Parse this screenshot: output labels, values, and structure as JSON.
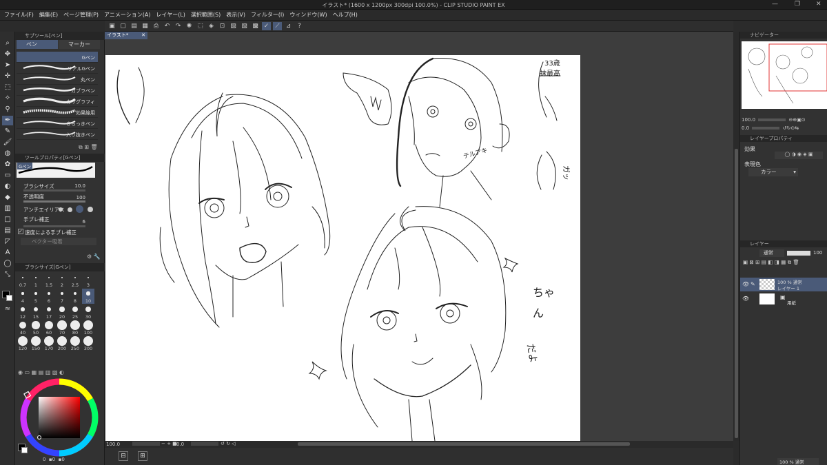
{
  "title": "イラスト* (1600 x 1200px 300dpi 100.0%) - CLIP STUDIO PAINT EX",
  "menu": [
    "ファイル(F)",
    "編集(E)",
    "ページ管理(P)",
    "アニメーション(A)",
    "レイヤー(L)",
    "選択範囲(S)",
    "表示(V)",
    "フィルター(I)",
    "ウィンドウ(W)",
    "ヘルプ(H)"
  ],
  "subtool": {
    "header": "サブツール[ペン]",
    "tab_pen": "ペン",
    "tab_marker": "マーカー",
    "brushes": [
      "Gペン",
      "リアルGペン",
      "丸ペン",
      "カブラペン",
      "カリグラフィ",
      "効果線用",
      "さらっきペン",
      "入り抜きペン"
    ]
  },
  "toolprop": {
    "header": "ツールプロパティ[Gペン]",
    "brush_name": "Gペン",
    "brush_size_label": "ブラシサイズ",
    "brush_size_value": "10.0",
    "opacity_label": "不透明度",
    "opacity_value": "100",
    "antialias_label": "アンチエイリアス",
    "stabilization_label": "手ブレ補正",
    "stabilization_value": "6",
    "speed_stab_label": "速度による手ブレ補正",
    "vector_label": "ベクター吸着"
  },
  "brushsize": {
    "header": "ブラシサイズ[Gペン]",
    "sizes": [
      "0.7",
      "1",
      "1.5",
      "2",
      "2.5",
      "3",
      "4",
      "5",
      "6",
      "7",
      "8",
      "10",
      "12",
      "15",
      "17",
      "20",
      "25",
      "30",
      "40",
      "50",
      "60",
      "70",
      "80",
      "100",
      "120",
      "150",
      "170",
      "200",
      "250",
      "300"
    ]
  },
  "colors": {
    "main": "#000000",
    "sub": "#ffffff",
    "accent": "#4a5a78",
    "picker_hue": "#ff0000"
  },
  "color_values": {
    "a": "0",
    "b": "0",
    "c": "0"
  },
  "document": {
    "tab": "イラスト*",
    "status_zoom": "100.0",
    "status_angle": "0.0"
  },
  "annotations": {
    "top_right_1": "33歳",
    "top_right_2": "抹最高",
    "side_name": "テルアキ",
    "side_text": "ガッ",
    "right_text_1": "ちゃ",
    "right_text_2": "ん",
    "right_text_3": "だよ"
  },
  "navigator": {
    "header": "ナビゲーター",
    "zoom": "100.0",
    "angle": "0.0"
  },
  "layerprop": {
    "header": "レイヤープロパティ",
    "effect_label": "効果",
    "expression_label": "表現色",
    "expression_value": "カラー"
  },
  "layers": {
    "header": "レイヤー",
    "blend_mode": "通常",
    "opacity": "100",
    "items": [
      {
        "mode": "100 % 通常",
        "name": "レイヤー 1"
      },
      {
        "mode": "",
        "name": "用紙"
      }
    ],
    "bottom_mode": "100 % 通常"
  }
}
